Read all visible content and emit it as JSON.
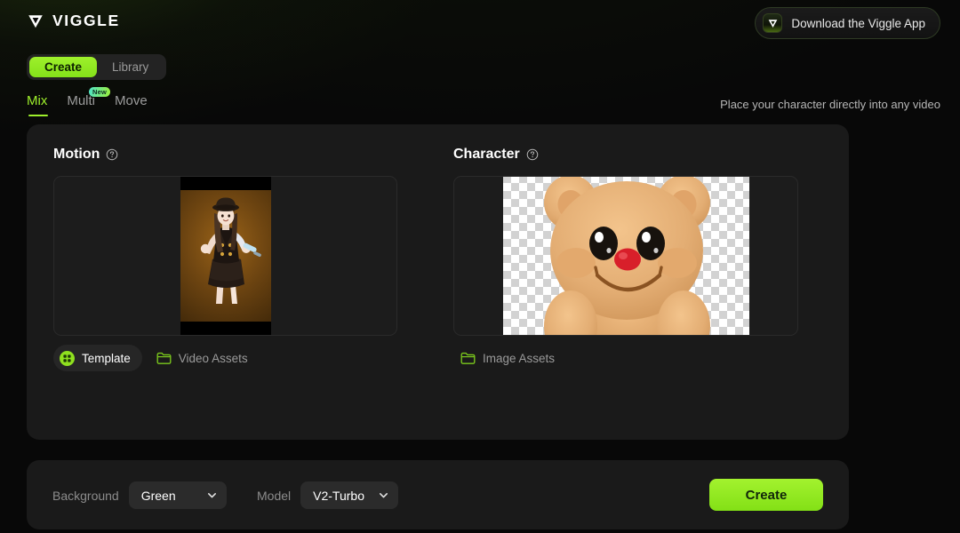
{
  "brand": {
    "name": "VIGGLE",
    "logo_icon": "viggle-v-mark"
  },
  "header": {
    "download_button": {
      "label": "Download the Viggle App",
      "icon": "viggle-app-icon"
    }
  },
  "segmented": {
    "items": [
      {
        "label": "Create",
        "active": true
      },
      {
        "label": "Library",
        "active": false
      }
    ]
  },
  "subtabs": {
    "items": [
      {
        "label": "Mix",
        "active": true,
        "badge": ""
      },
      {
        "label": "Multi",
        "active": false,
        "badge": "New"
      },
      {
        "label": "Move",
        "active": false,
        "badge": ""
      }
    ],
    "tagline": "Place your character directly into any video"
  },
  "motion": {
    "title": "Motion",
    "help_icon": "question-circle-icon",
    "actions": [
      {
        "label": "Template",
        "icon": "template-grid-icon",
        "primary": true
      },
      {
        "label": "Video Assets",
        "icon": "folder-icon",
        "primary": false
      }
    ]
  },
  "character": {
    "title": "Character",
    "help_icon": "question-circle-icon",
    "actions": [
      {
        "label": "Image Assets",
        "icon": "folder-icon",
        "primary": false
      }
    ]
  },
  "bottom": {
    "background": {
      "label": "Background",
      "value": "Green",
      "chevron": "chevron-down-icon"
    },
    "model": {
      "label": "Model",
      "value": "V2-Turbo",
      "chevron": "chevron-down-icon"
    },
    "create_label": "Create"
  },
  "colors": {
    "accent_green": "#9ef02b",
    "panel_bg": "#1a1a1a",
    "page_bg": "#080808",
    "badge_gradient_start": "#4fe3c8",
    "badge_gradient_end": "#9cf03a"
  }
}
